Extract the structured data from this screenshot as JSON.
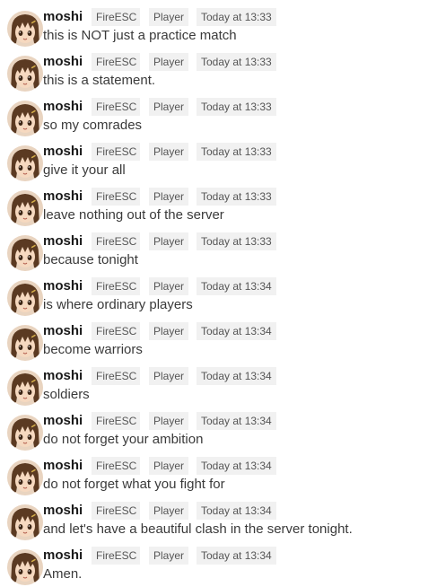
{
  "messages": [
    {
      "username": "moshi",
      "clan": "FireESC",
      "role": "Player",
      "time": "Today at 13:33",
      "text": "this is NOT just a practice match"
    },
    {
      "username": "moshi",
      "clan": "FireESC",
      "role": "Player",
      "time": "Today at 13:33",
      "text": "this is a statement."
    },
    {
      "username": "moshi",
      "clan": "FireESC",
      "role": "Player",
      "time": "Today at 13:33",
      "text": "so my comrades"
    },
    {
      "username": "moshi",
      "clan": "FireESC",
      "role": "Player",
      "time": "Today at 13:33",
      "text": "give it your all"
    },
    {
      "username": "moshi",
      "clan": "FireESC",
      "role": "Player",
      "time": "Today at 13:33",
      "text": "leave nothing out of the server"
    },
    {
      "username": "moshi",
      "clan": "FireESC",
      "role": "Player",
      "time": "Today at 13:33",
      "text": "because tonight"
    },
    {
      "username": "moshi",
      "clan": "FireESC",
      "role": "Player",
      "time": "Today at 13:34",
      "text": "is where ordinary players"
    },
    {
      "username": "moshi",
      "clan": "FireESC",
      "role": "Player",
      "time": "Today at 13:34",
      "text": "become warriors"
    },
    {
      "username": "moshi",
      "clan": "FireESC",
      "role": "Player",
      "time": "Today at 13:34",
      "text": "soldiers"
    },
    {
      "username": "moshi",
      "clan": "FireESC",
      "role": "Player",
      "time": "Today at 13:34",
      "text": "do not forget your ambition"
    },
    {
      "username": "moshi",
      "clan": "FireESC",
      "role": "Player",
      "time": "Today at 13:34",
      "text": "do not forget what you fight for"
    },
    {
      "username": "moshi",
      "clan": "FireESC",
      "role": "Player",
      "time": "Today at 13:34",
      "text": "and let's have a beautiful clash in the server tonight."
    },
    {
      "username": "moshi",
      "clan": "FireESC",
      "role": "Player",
      "time": "Today at 13:34",
      "text": "Amen."
    }
  ],
  "avatar": {
    "icon": "anime-girl-avatar-icon",
    "hair_color": "#5b3a22",
    "skin_color": "#f6d9c0"
  },
  "colors": {
    "username": "#1a1a1a",
    "text": "#3a3a3a",
    "tag_bg": "#f1f1f1",
    "tag_text": "#555555"
  }
}
